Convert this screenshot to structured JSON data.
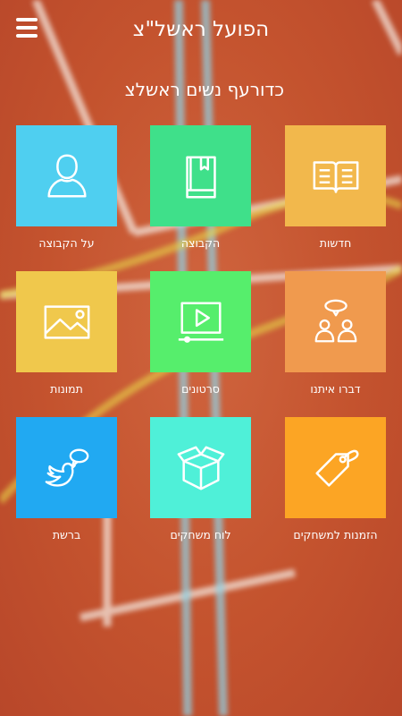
{
  "header": {
    "title": "הפועל ראשל\"צ"
  },
  "subtitle": "כדורעף נשים ראשלצ",
  "colors": {
    "about": "#4fcff0",
    "team": "#3fe08a",
    "news": "#f2b84c",
    "photos": "#f0c84c",
    "videos": "#56ee6c",
    "contact": "#f09a4e",
    "social": "#21a9f2",
    "schedule": "#4ff0d8",
    "tickets": "#fca524"
  },
  "tiles": [
    {
      "label": "על הקבוצה",
      "icon": "person-icon"
    },
    {
      "label": "הקבוצה",
      "icon": "book-icon"
    },
    {
      "label": "חדשות",
      "icon": "open-book-icon"
    },
    {
      "label": "תמונות",
      "icon": "image-icon"
    },
    {
      "label": "סרטונים",
      "icon": "video-icon"
    },
    {
      "label": "דברו איתנו",
      "icon": "chat-people-icon"
    },
    {
      "label": "ברשת",
      "icon": "twitter-bird-icon"
    },
    {
      "label": "לוח משחקים",
      "icon": "box-icon"
    },
    {
      "label": "הזמנות למשחקים",
      "icon": "tag-icon"
    }
  ]
}
